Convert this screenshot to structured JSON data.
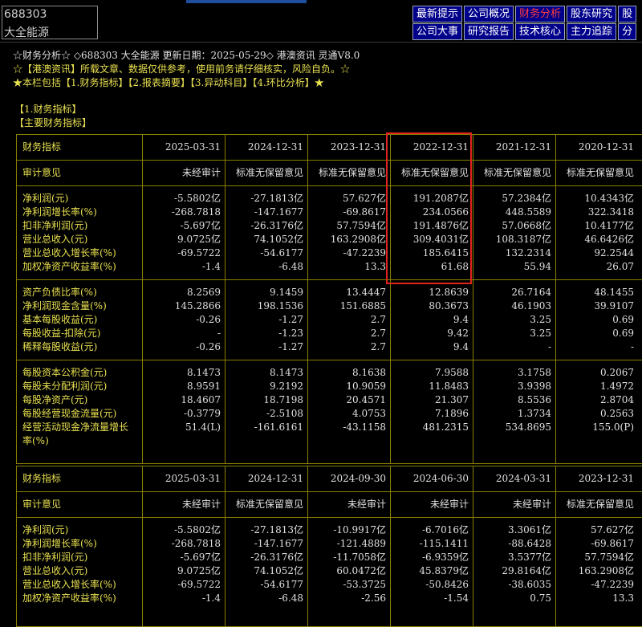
{
  "stock": {
    "code": "688303",
    "name": "大全能源"
  },
  "nav": {
    "row1": [
      "最新提示",
      "公司概况",
      "财务分析",
      "股东研究",
      "股"
    ],
    "row2": [
      "公司大事",
      "研究报告",
      "技术核心",
      "主力追踪",
      "分"
    ],
    "active": "财务分析"
  },
  "info": {
    "line1": "☆财务分析☆ ◇688303 大全能源 更新日期：2025-05-29◇ 港澳资讯 灵通V8.0",
    "line2": "☆【港澳资讯】所载文章、数据仅供参考，使用前务请仔细核实，风险自负。☆",
    "line3": "★本栏包括【1.财务指标】【2.报表摘要】【3.异动科目】【4.环比分析】★"
  },
  "sections": {
    "s1": "【1.财务指标】",
    "s2": "【主要财务指标】"
  },
  "table1": {
    "header": [
      "财务指标",
      "2025-03-31",
      "2024-12-31",
      "2023-12-31",
      "2022-12-31",
      "2021-12-31",
      "2020-12-31"
    ],
    "groups": [
      [
        [
          "审计意见",
          "未经审计",
          "标准无保留意见",
          "标准无保留意见",
          "标准无保留意见",
          "标准无保留意见",
          "标准无保留意见"
        ]
      ],
      [
        [
          "净利润(元)",
          "-5.5802亿",
          "-27.1813亿",
          "57.627亿",
          "191.2087亿",
          "57.2384亿",
          "10.4343亿"
        ],
        [
          "净利润增长率(%)",
          "-268.7818",
          "-147.1677",
          "-69.8617",
          "234.0566",
          "448.5589",
          "322.3418"
        ],
        [
          "扣非净利润(元)",
          "-5.697亿",
          "-26.3176亿",
          "57.7594亿",
          "191.4876亿",
          "57.0668亿",
          "10.4177亿"
        ],
        [
          "营业总收入(元)",
          "9.0725亿",
          "74.1052亿",
          "163.2908亿",
          "309.4031亿",
          "108.3187亿",
          "46.6426亿"
        ],
        [
          "营业总收入增长率(%)",
          "-69.5722",
          "-54.6177",
          "-47.2239",
          "185.6415",
          "132.2314",
          "92.2544"
        ],
        [
          "加权净资产收益率(%)",
          "-1.4",
          "-6.48",
          "13.3",
          "61.68",
          "55.94",
          "26.07"
        ]
      ],
      [
        [
          "资产负债比率(%)",
          "8.2569",
          "9.1459",
          "13.4447",
          "12.8639",
          "26.7164",
          "48.1455"
        ],
        [
          "净利润现金含量(%)",
          "145.2866",
          "198.1536",
          "151.6885",
          "80.3673",
          "46.1903",
          "39.9107"
        ],
        [
          "基本每股收益(元)",
          "-0.26",
          "-1.27",
          "2.7",
          "9.4",
          "3.25",
          "0.69"
        ],
        [
          "每股收益-扣除(元)",
          "-",
          "-1.23",
          "2.7",
          "9.42",
          "3.25",
          "0.69"
        ],
        [
          "稀释每股收益(元)",
          "-0.26",
          "-1.27",
          "2.7",
          "9.4",
          "-",
          "-"
        ]
      ],
      [
        [
          "每股资本公积金(元)",
          "8.1473",
          "8.1473",
          "8.1638",
          "7.9588",
          "3.1758",
          "0.2067"
        ],
        [
          "每股未分配利润(元)",
          "8.9591",
          "9.2192",
          "10.9059",
          "11.8483",
          "3.9398",
          "1.4972"
        ],
        [
          "每股净资产(元)",
          "18.4607",
          "18.7198",
          "20.4571",
          "21.307",
          "8.5536",
          "2.8704"
        ],
        [
          "每股经营现金流量(元)",
          "-0.3779",
          "-2.5108",
          "4.0753",
          "7.1896",
          "1.3734",
          "0.2563"
        ],
        [
          "经营活动现金净流量增长",
          "51.4(L)",
          "-161.6161",
          "-43.1158",
          "481.2315",
          "534.8695",
          "155.0(P)"
        ],
        [
          "率(%)",
          "",
          "",
          "",
          "",
          "",
          ""
        ]
      ]
    ]
  },
  "table2": {
    "header": [
      "财务指标",
      "2025-03-31",
      "2024-12-31",
      "2024-09-30",
      "2024-06-30",
      "2024-03-31",
      "2023-12-31"
    ],
    "groups": [
      [
        [
          "审计意见",
          "未经审计",
          "标准无保留意见",
          "未经审计",
          "未经审计",
          "未经审计",
          "标准无保留意见"
        ]
      ],
      [
        [
          "净利润(元)",
          "-5.5802亿",
          "-27.1813亿",
          "-10.9917亿",
          "-6.7016亿",
          "3.3061亿",
          "57.627亿"
        ],
        [
          "净利润增长率(%)",
          "-268.7818",
          "-147.1677",
          "-121.4889",
          "-115.1411",
          "-88.6428",
          "-69.8617"
        ],
        [
          "扣非净利润(元)",
          "-5.697亿",
          "-26.3176亿",
          "-11.7058亿",
          "-6.9359亿",
          "3.5377亿",
          "57.7594亿"
        ],
        [
          "营业总收入(元)",
          "9.0725亿",
          "74.1052亿",
          "60.0472亿",
          "45.8379亿",
          "29.8164亿",
          "163.2908亿"
        ],
        [
          "营业总收入增长率(%)",
          "-69.5722",
          "-54.6177",
          "-53.3725",
          "-50.8426",
          "-38.6035",
          "-47.2239"
        ],
        [
          "加权净资产收益率(%)",
          "-1.4",
          "-6.48",
          "-2.56",
          "-1.54",
          "0.75",
          "13.3"
        ]
      ]
    ]
  }
}
